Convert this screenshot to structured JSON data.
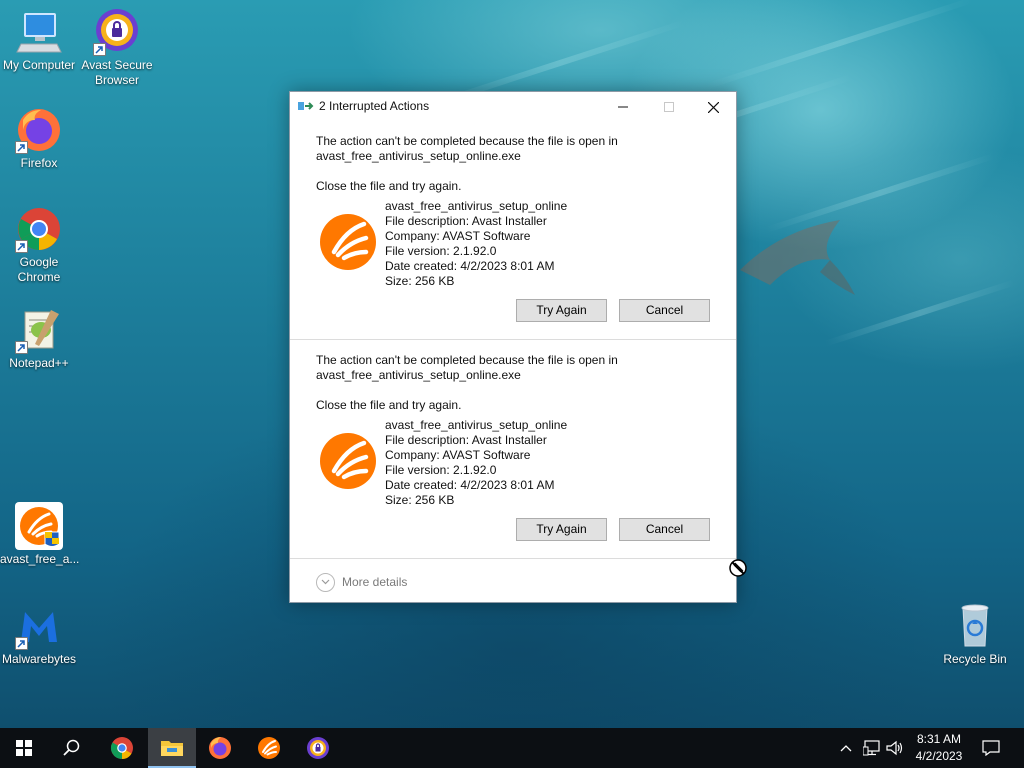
{
  "desktop": {
    "icons": [
      {
        "label": "My Computer"
      },
      {
        "label": "Avast Secure Browser"
      },
      {
        "label": "Firefox"
      },
      {
        "label": "Google Chrome"
      },
      {
        "label": "Notepad++"
      },
      {
        "label": "avast_free_a..."
      },
      {
        "label": "Malwarebytes"
      },
      {
        "label": "Recycle Bin"
      }
    ]
  },
  "dialog": {
    "title": "2 Interrupted Actions",
    "items": [
      {
        "message_line1": "The action can't be completed because the file is open in",
        "message_line2": "avast_free_antivirus_setup_online.exe",
        "instruction": "Close the file and try again.",
        "file_name": "avast_free_antivirus_setup_online",
        "file_description": "File description: Avast Installer",
        "company": "Company: AVAST Software",
        "file_version": "File version: 2.1.92.0",
        "date_created": "Date created: 4/2/2023 8:01 AM",
        "size": "Size: 256 KB",
        "try_again_label": "Try Again",
        "cancel_label": "Cancel"
      },
      {
        "message_line1": "The action can't be completed because the file is open in",
        "message_line2": "avast_free_antivirus_setup_online.exe",
        "instruction": "Close the file and try again.",
        "file_name": "avast_free_antivirus_setup_online",
        "file_description": "File description: Avast Installer",
        "company": "Company: AVAST Software",
        "file_version": "File version: 2.1.92.0",
        "date_created": "Date created: 4/2/2023 8:01 AM",
        "size": "Size: 256 KB",
        "try_again_label": "Try Again",
        "cancel_label": "Cancel"
      }
    ],
    "more_details_label": "More details"
  },
  "taskbar": {
    "apps": [
      "start-icon",
      "search-icon",
      "chrome-icon",
      "file-explorer-icon",
      "firefox-icon",
      "avast-icon",
      "avast-secure-browser-icon"
    ],
    "time": "8:31 AM",
    "date": "4/2/2023"
  },
  "colors": {
    "avast_orange": "#ff7800",
    "taskbar_bg": "#0c0f13",
    "button_bg": "#e1e1e1"
  }
}
